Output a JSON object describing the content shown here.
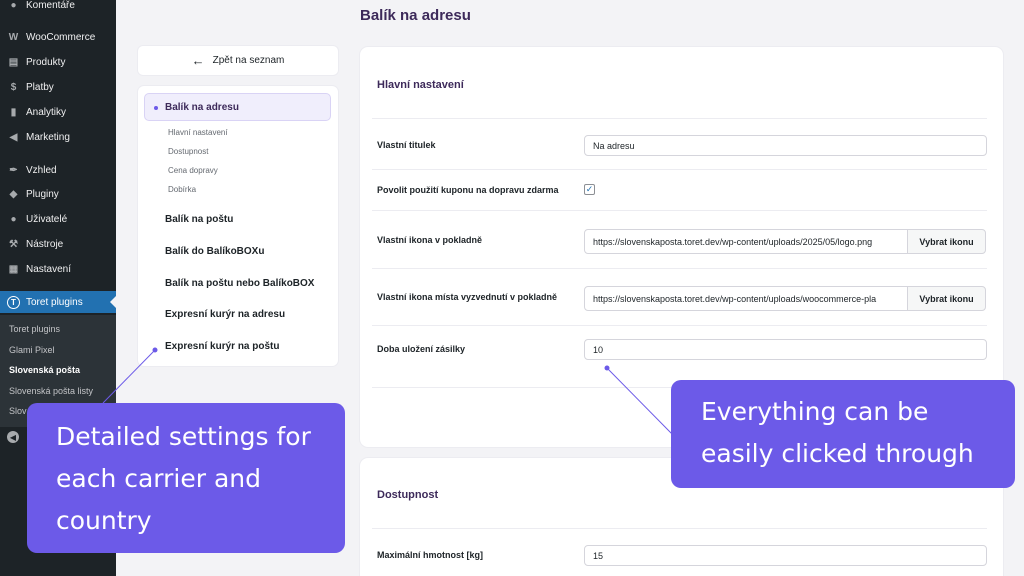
{
  "sidebar": {
    "items": [
      {
        "label": "Komentáře",
        "icon": "comment-icon"
      },
      {
        "label": "WooCommerce",
        "icon": "woo-icon"
      },
      {
        "label": "Produkty",
        "icon": "archive-icon"
      },
      {
        "label": "Platby",
        "icon": "payments-icon"
      },
      {
        "label": "Analytiky",
        "icon": "chart-icon"
      },
      {
        "label": "Marketing",
        "icon": "megaphone-icon"
      },
      {
        "label": "Vzhled",
        "icon": "brush-icon"
      },
      {
        "label": "Pluginy",
        "icon": "plugin-icon"
      },
      {
        "label": "Uživatelé",
        "icon": "user-icon"
      },
      {
        "label": "Nástroje",
        "icon": "wrench-icon"
      },
      {
        "label": "Nastavení",
        "icon": "settings-icon"
      },
      {
        "label": "Toret plugins",
        "icon": "toret-icon"
      }
    ],
    "submenu": [
      "Toret plugins",
      "Glami Pixel",
      "Slovenská pošta",
      "Slovenská pošta listy",
      "Slov"
    ]
  },
  "page": {
    "title": "Balík na adresu"
  },
  "nav": {
    "back_label": "Zpět na seznam",
    "active": "Balík na adresu",
    "active_subs": [
      "Hlavní nastavení",
      "Dostupnost",
      "Cena dopravy",
      "Dobírka"
    ],
    "others": [
      "Balík na poštu",
      "Balík do BalíkoBOXu",
      "Balík na poštu nebo BalíkoBOX",
      "Expresní kurýr na adresu",
      "Expresní kurýr na poštu"
    ]
  },
  "main_settings": {
    "title": "Hlavní nastavení",
    "custom_title_label": "Vlastní titulek",
    "custom_title_value": "Na adresu",
    "coupon_label": "Povolit použití kuponu na dopravu zdarma",
    "coupon_checked": true,
    "icon_label": "Vlastní ikona v pokladně",
    "icon_value": "https://slovenskaposta.toret.dev/wp-content/uploads/2025/05/logo.png",
    "icon_button": "Vybrat ikonu",
    "pickup_icon_label": "Vlastní ikona místa vyzvednutí v pokladně",
    "pickup_icon_value": "https://slovenskaposta.toret.dev/wp-content/uploads/woocommerce-pla",
    "pickup_icon_button": "Vybrat ikonu",
    "storage_label": "Doba uložení zásilky",
    "storage_value": "10"
  },
  "availability": {
    "title": "Dostupnost",
    "max_weight_label": "Maximální hmotnost [kg]",
    "max_weight_value": "15"
  },
  "callouts": {
    "left": [
      "Detailed settings for",
      "each carrier and",
      "country"
    ],
    "right": [
      "Everything can be",
      "easily clicked through"
    ]
  }
}
